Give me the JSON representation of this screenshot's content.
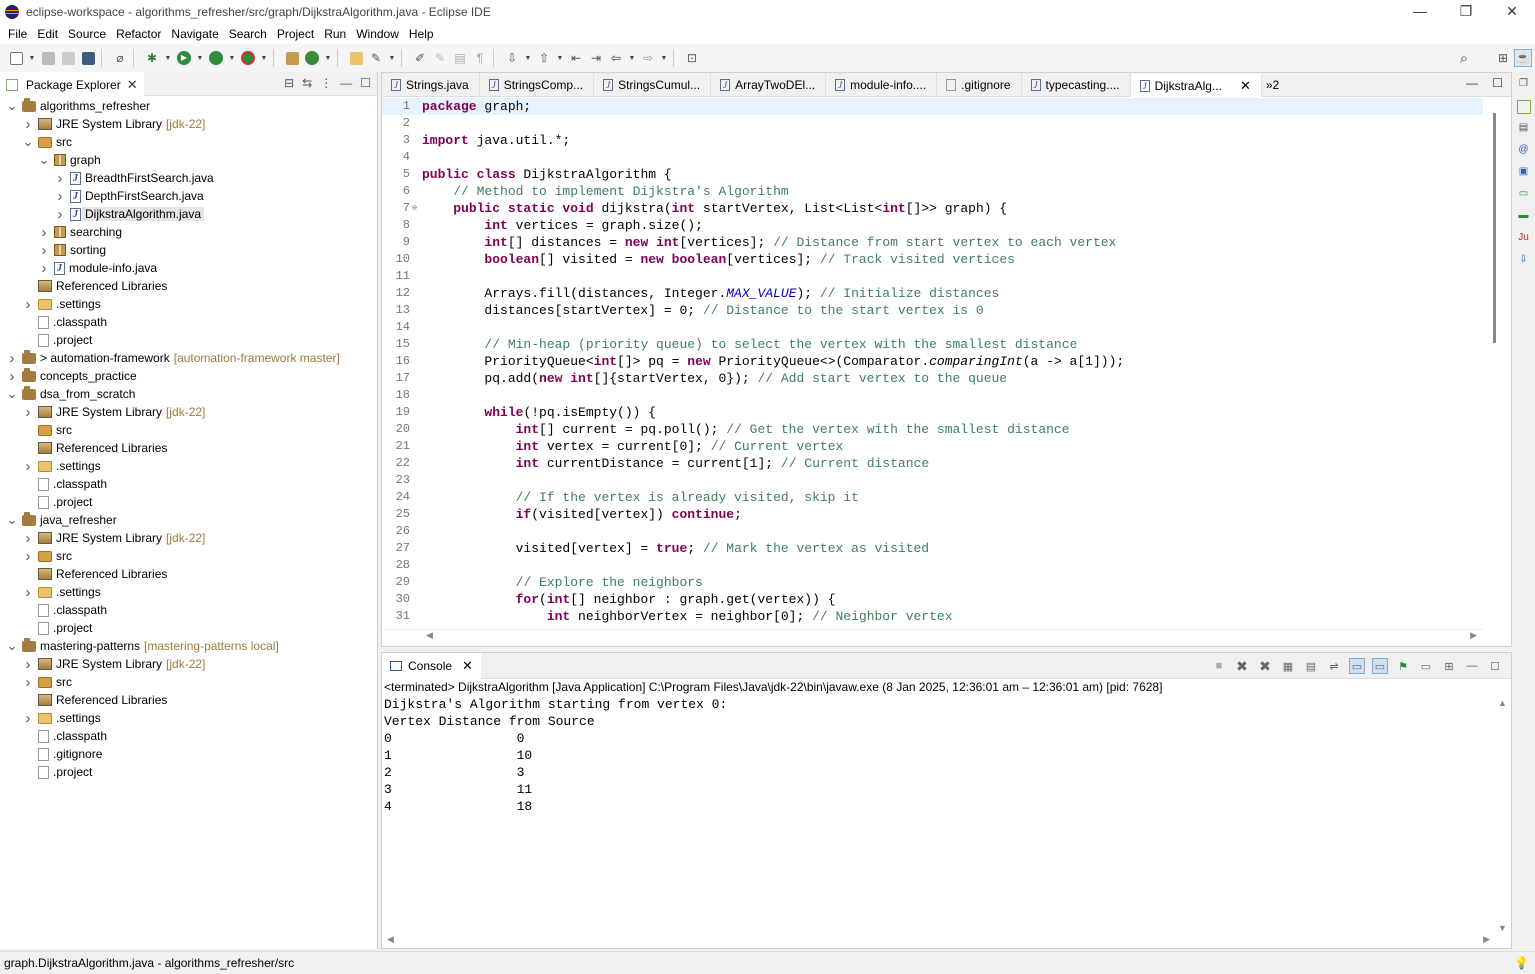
{
  "window": {
    "title": "eclipse-workspace - algorithms_refresher/src/graph/DijkstraAlgorithm.java - Eclipse IDE",
    "minimize": "—",
    "restore": "❐",
    "close": "✕"
  },
  "menu": [
    "File",
    "Edit",
    "Source",
    "Refactor",
    "Navigate",
    "Search",
    "Project",
    "Run",
    "Window",
    "Help"
  ],
  "package_explorer": {
    "title": "Package Explorer",
    "tree": [
      {
        "depth": 0,
        "arrow": "v",
        "icon": "proj",
        "label": "algorithms_refresher",
        "deco": ""
      },
      {
        "depth": 1,
        "arrow": ">",
        "icon": "lib",
        "label": "JRE System Library",
        "deco": "[jdk-22]"
      },
      {
        "depth": 1,
        "arrow": "v",
        "icon": "src",
        "label": "src",
        "deco": ""
      },
      {
        "depth": 2,
        "arrow": "v",
        "icon": "pkg",
        "label": "graph",
        "deco": ""
      },
      {
        "depth": 3,
        "arrow": ">",
        "icon": "java",
        "label": "BreadthFirstSearch.java",
        "deco": ""
      },
      {
        "depth": 3,
        "arrow": ">",
        "icon": "java",
        "label": "DepthFirstSearch.java",
        "deco": ""
      },
      {
        "depth": 3,
        "arrow": ">",
        "icon": "java",
        "label": "DijkstraAlgorithm.java",
        "deco": "",
        "selected": true
      },
      {
        "depth": 2,
        "arrow": ">",
        "icon": "pkg",
        "label": "searching",
        "deco": ""
      },
      {
        "depth": 2,
        "arrow": ">",
        "icon": "pkg",
        "label": "sorting",
        "deco": ""
      },
      {
        "depth": 2,
        "arrow": ">",
        "icon": "java",
        "label": "module-info.java",
        "deco": ""
      },
      {
        "depth": 1,
        "arrow": "",
        "icon": "lib",
        "label": "Referenced Libraries",
        "deco": ""
      },
      {
        "depth": 1,
        "arrow": ">",
        "icon": "folder",
        "label": ".settings",
        "deco": ""
      },
      {
        "depth": 1,
        "arrow": "",
        "icon": "file",
        "label": ".classpath",
        "deco": ""
      },
      {
        "depth": 1,
        "arrow": "",
        "icon": "file",
        "label": ".project",
        "deco": ""
      },
      {
        "depth": 0,
        "arrow": ">",
        "icon": "proj",
        "label": "> automation-framework",
        "deco": "[automation-framework master]"
      },
      {
        "depth": 0,
        "arrow": ">",
        "icon": "proj",
        "label": "concepts_practice",
        "deco": ""
      },
      {
        "depth": 0,
        "arrow": "v",
        "icon": "proj",
        "label": "dsa_from_scratch",
        "deco": ""
      },
      {
        "depth": 1,
        "arrow": ">",
        "icon": "lib",
        "label": "JRE System Library",
        "deco": "[jdk-22]"
      },
      {
        "depth": 1,
        "arrow": "",
        "icon": "src",
        "label": "src",
        "deco": ""
      },
      {
        "depth": 1,
        "arrow": "",
        "icon": "lib",
        "label": "Referenced Libraries",
        "deco": ""
      },
      {
        "depth": 1,
        "arrow": ">",
        "icon": "folder",
        "label": ".settings",
        "deco": ""
      },
      {
        "depth": 1,
        "arrow": "",
        "icon": "file",
        "label": ".classpath",
        "deco": ""
      },
      {
        "depth": 1,
        "arrow": "",
        "icon": "file",
        "label": ".project",
        "deco": ""
      },
      {
        "depth": 0,
        "arrow": "v",
        "icon": "proj",
        "label": "java_refresher",
        "deco": ""
      },
      {
        "depth": 1,
        "arrow": ">",
        "icon": "lib",
        "label": "JRE System Library",
        "deco": "[jdk-22]"
      },
      {
        "depth": 1,
        "arrow": ">",
        "icon": "src",
        "label": "src",
        "deco": ""
      },
      {
        "depth": 1,
        "arrow": "",
        "icon": "lib",
        "label": "Referenced Libraries",
        "deco": ""
      },
      {
        "depth": 1,
        "arrow": ">",
        "icon": "folder",
        "label": ".settings",
        "deco": ""
      },
      {
        "depth": 1,
        "arrow": "",
        "icon": "file",
        "label": ".classpath",
        "deco": ""
      },
      {
        "depth": 1,
        "arrow": "",
        "icon": "file",
        "label": ".project",
        "deco": ""
      },
      {
        "depth": 0,
        "arrow": "v",
        "icon": "proj",
        "label": "mastering-patterns",
        "deco": "[mastering-patterns local]"
      },
      {
        "depth": 1,
        "arrow": ">",
        "icon": "lib",
        "label": "JRE System Library",
        "deco": "[jdk-22]"
      },
      {
        "depth": 1,
        "arrow": ">",
        "icon": "src",
        "label": "src",
        "deco": ""
      },
      {
        "depth": 1,
        "arrow": "",
        "icon": "lib",
        "label": "Referenced Libraries",
        "deco": ""
      },
      {
        "depth": 1,
        "arrow": ">",
        "icon": "folder",
        "label": ".settings",
        "deco": ""
      },
      {
        "depth": 1,
        "arrow": "",
        "icon": "file",
        "label": ".classpath",
        "deco": ""
      },
      {
        "depth": 1,
        "arrow": "",
        "icon": "file",
        "label": ".gitignore",
        "deco": ""
      },
      {
        "depth": 1,
        "arrow": "",
        "icon": "file",
        "label": ".project",
        "deco": ""
      }
    ]
  },
  "editor": {
    "tabs": [
      {
        "label": "Strings.java",
        "active": false
      },
      {
        "label": "StringsComp...",
        "active": false
      },
      {
        "label": "StringsCumul...",
        "active": false
      },
      {
        "label": "ArrayTwoDEl...",
        "active": false
      },
      {
        "label": "module-info....",
        "active": false
      },
      {
        "label": ".gitignore",
        "active": false
      },
      {
        "label": "typecasting....",
        "active": false
      },
      {
        "label": "DijkstraAlg...",
        "active": true
      }
    ],
    "overflow": "»2",
    "lines": [
      [
        [
          "kw",
          "package"
        ],
        [
          "",
          "graph;"
        ]
      ],
      [],
      [
        [
          "kw",
          "import"
        ],
        [
          "",
          "java.util.*;"
        ]
      ],
      [],
      [
        [
          "kw",
          "public class"
        ],
        [
          "",
          "DijkstraAlgorithm {"
        ]
      ],
      [
        [
          "",
          "    "
        ],
        [
          "cm",
          "// Method to implement Dijkstra's Algorithm"
        ]
      ],
      [
        [
          "",
          "    "
        ],
        [
          "kw",
          "public static void"
        ],
        [
          "",
          "dijkstra("
        ],
        [
          "kw",
          "int"
        ],
        [
          "",
          "startVertex, List<List<"
        ],
        [
          "kw",
          "int"
        ],
        [
          "",
          "[]>> graph) {"
        ]
      ],
      [
        [
          "",
          "        "
        ],
        [
          "kw",
          "int"
        ],
        [
          "",
          "vertices = graph.size();"
        ]
      ],
      [
        [
          "",
          "        "
        ],
        [
          "kw",
          "int"
        ],
        [
          "",
          "[] distances = "
        ],
        [
          "kw",
          "new int"
        ],
        [
          "",
          "[vertices]; "
        ],
        [
          "cm",
          "// Distance from start vertex to each vertex"
        ]
      ],
      [
        [
          "",
          "        "
        ],
        [
          "kw",
          "boolean"
        ],
        [
          "",
          "[] visited = "
        ],
        [
          "kw",
          "new boolean"
        ],
        [
          "",
          "[vertices]; "
        ],
        [
          "cm",
          "// Track visited vertices"
        ]
      ],
      [],
      [
        [
          "",
          "        Arrays.fill(distances, Integer."
        ],
        [
          "fld",
          "MAX_VALUE"
        ],
        [
          "",
          "); "
        ],
        [
          "cm",
          "// Initialize distances"
        ]
      ],
      [
        [
          "",
          "        distances[startVertex] = 0; "
        ],
        [
          "cm",
          "// Distance to the start vertex is 0"
        ]
      ],
      [],
      [
        [
          "",
          "        "
        ],
        [
          "cm",
          "// Min-heap (priority queue) to select the vertex with the smallest distance"
        ]
      ],
      [
        [
          "",
          "        PriorityQueue<"
        ],
        [
          "kw",
          "int"
        ],
        [
          "",
          "[]> pq = "
        ],
        [
          "kw",
          "new"
        ],
        [
          "",
          "PriorityQueue<>(Comparator."
        ],
        [
          "itl",
          "comparingInt"
        ],
        [
          "",
          "(a -> a[1]));"
        ]
      ],
      [
        [
          "",
          "        pq.add("
        ],
        [
          "kw",
          "new int"
        ],
        [
          "",
          "[]{startVertex, 0}); "
        ],
        [
          "cm",
          "// Add start vertex to the queue"
        ]
      ],
      [],
      [
        [
          "",
          "        "
        ],
        [
          "kw",
          "while"
        ],
        [
          "",
          "(!pq.isEmpty()) {"
        ]
      ],
      [
        [
          "",
          "            "
        ],
        [
          "kw",
          "int"
        ],
        [
          "",
          "[] current = pq.poll(); "
        ],
        [
          "cm",
          "// Get the vertex with the smallest distance"
        ]
      ],
      [
        [
          "",
          "            "
        ],
        [
          "kw",
          "int"
        ],
        [
          "",
          "vertex = current[0]; "
        ],
        [
          "cm",
          "// Current vertex"
        ]
      ],
      [
        [
          "",
          "            "
        ],
        [
          "kw",
          "int"
        ],
        [
          "",
          "currentDistance = current[1]; "
        ],
        [
          "cm",
          "// Current distance"
        ]
      ],
      [],
      [
        [
          "",
          "            "
        ],
        [
          "cm",
          "// If the vertex is already visited, skip it"
        ]
      ],
      [
        [
          "",
          "            "
        ],
        [
          "kw",
          "if"
        ],
        [
          "",
          "(visited[vertex]) "
        ],
        [
          "kw",
          "continue"
        ],
        [
          "",
          ";"
        ]
      ],
      [],
      [
        [
          "",
          "            visited[vertex] = "
        ],
        [
          "kw",
          "true"
        ],
        [
          "",
          "; "
        ],
        [
          "cm",
          "// Mark the vertex as visited"
        ]
      ],
      [],
      [
        [
          "",
          "            "
        ],
        [
          "cm",
          "// Explore the neighbors"
        ]
      ],
      [
        [
          "",
          "            "
        ],
        [
          "kw",
          "for"
        ],
        [
          "",
          "("
        ],
        [
          "kw",
          "int"
        ],
        [
          "",
          "[] neighbor : graph.get(vertex)) {"
        ]
      ],
      [
        [
          "",
          "                "
        ],
        [
          "kw",
          "int"
        ],
        [
          "",
          "neighborVertex = neighbor[0]; "
        ],
        [
          "cm",
          "// Neighbor vertex"
        ]
      ]
    ]
  },
  "console": {
    "title": "Console",
    "terminated": "<terminated> DijkstraAlgorithm [Java Application] C:\\Program Files\\Java\\jdk-22\\bin\\javaw.exe  (8 Jan 2025, 12:36:01 am – 12:36:01 am) [pid: 7628]",
    "output": [
      "Dijkstra's Algorithm starting from vertex 0:",
      "Vertex Distance from Source",
      "0                0",
      "1                10",
      "2                3",
      "3                11",
      "4                18"
    ]
  },
  "status": {
    "text": "graph.DijkstraAlgorithm.java - algorithms_refresher/src"
  }
}
